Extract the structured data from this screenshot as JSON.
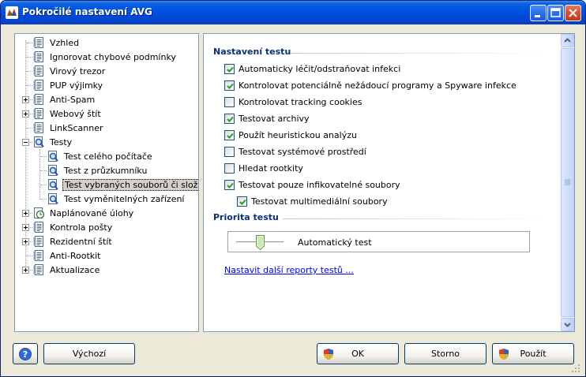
{
  "window": {
    "title": "Pokročilé nastavení AVG"
  },
  "tree": {
    "items": [
      {
        "label": "Vzhled"
      },
      {
        "label": "Ignorovat chybové podmínky"
      },
      {
        "label": "Virový trezor"
      },
      {
        "label": "PUP výjimky"
      },
      {
        "label": "Anti-Spam"
      },
      {
        "label": "Webový štít"
      },
      {
        "label": "LinkScanner"
      },
      {
        "label": "Testy"
      },
      {
        "label": "Test celého počítače"
      },
      {
        "label": "Test z průzkumníku"
      },
      {
        "label": "Test vybraných souborů či složek"
      },
      {
        "label": "Test vyměnitelných zařízení"
      },
      {
        "label": "Naplánované úlohy"
      },
      {
        "label": "Kontrola pošty"
      },
      {
        "label": "Rezidentní štít"
      },
      {
        "label": "Anti-Rootkit"
      },
      {
        "label": "Aktualizace"
      }
    ]
  },
  "settings": {
    "section_title": "Nastavení testu",
    "options": [
      {
        "label": "Automaticky léčit/odstraňovat infekci",
        "checked": true
      },
      {
        "label": "Kontrolovat potenciálně nežádoucí programy a Spyware infekce",
        "checked": true
      },
      {
        "label": "Kontrolovat tracking cookies",
        "checked": false
      },
      {
        "label": "Testovat archivy",
        "checked": true
      },
      {
        "label": "Použít heuristickou analýzu",
        "checked": true
      },
      {
        "label": "Testovat systémové prostředí",
        "checked": false
      },
      {
        "label": "Hledat rootkity",
        "checked": false
      },
      {
        "label": "Testovat pouze infikovatelné soubory",
        "checked": true
      },
      {
        "label": "Testovat multimediální soubory",
        "checked": true
      }
    ],
    "priority_title": "Priorita testu",
    "priority_value": "Automatický test",
    "priority_level": 0.5,
    "report_link": "Nastavit další reporty testů ..."
  },
  "buttons": {
    "default": "Výchozí",
    "ok": "OK",
    "cancel": "Storno",
    "apply": "Použít"
  },
  "icons": {
    "app": "avg-icon",
    "help": "help-icon",
    "shield": "shield-icon"
  },
  "colors": {
    "titlebar": "#0054e3",
    "section_title": "#0c2f7a",
    "link": "#0000ff",
    "checkmark": "#21a121"
  }
}
